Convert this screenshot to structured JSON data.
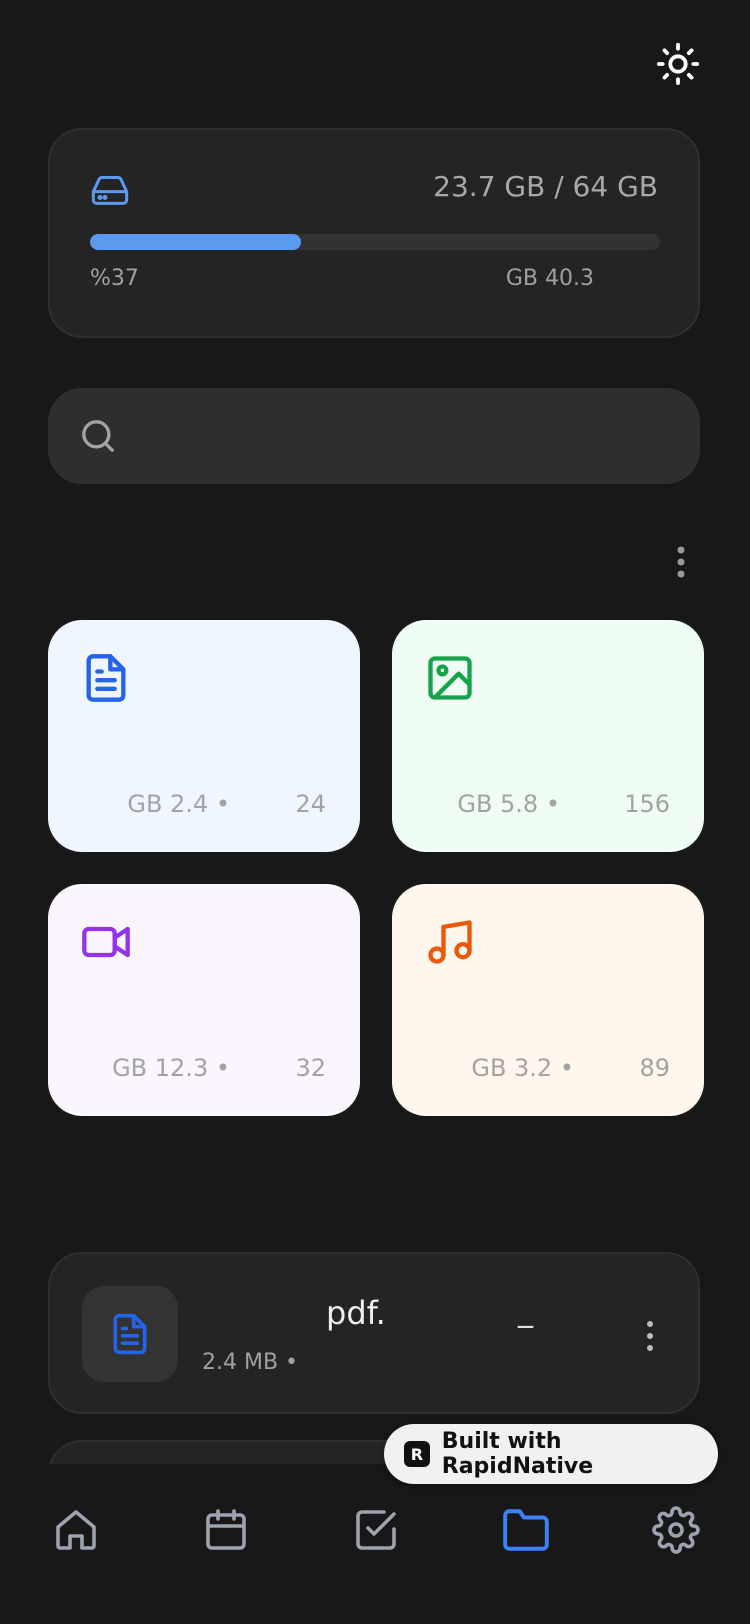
{
  "storage": {
    "total_label": "23.7 GB / 64 GB",
    "percent_label": "%37",
    "free_label": "GB 40.3",
    "used_fraction": 0.37,
    "bar_color": "#5a9bf0"
  },
  "search": {
    "placeholder": ""
  },
  "categories": [
    {
      "id": "documents",
      "icon": "document-icon",
      "size": "GB 2.4 •",
      "count": "24",
      "bg": "#eff6ff",
      "color": "#2563eb"
    },
    {
      "id": "images",
      "icon": "image-icon",
      "size": "GB 5.8 •",
      "count": "156",
      "bg": "#f0fdf4",
      "color": "#16a34a"
    },
    {
      "id": "videos",
      "icon": "video-icon",
      "size": "GB 12.3 •",
      "count": "32",
      "bg": "#faf5ff",
      "color": "#9333ea"
    },
    {
      "id": "music",
      "icon": "music-icon",
      "size": "GB 3.2 •",
      "count": "89",
      "bg": "#fff7ed",
      "color": "#ea580c"
    }
  ],
  "recent_files": [
    {
      "name": "pdf.",
      "meta": "2.4 MB •",
      "date": "_",
      "icon": "document-icon"
    }
  ],
  "tabs": [
    {
      "id": "home",
      "icon": "home-icon",
      "active": false
    },
    {
      "id": "calendar",
      "icon": "calendar-icon",
      "active": false
    },
    {
      "id": "tasks",
      "icon": "checkbox-icon",
      "active": false
    },
    {
      "id": "files",
      "icon": "folder-icon",
      "active": true
    },
    {
      "id": "settings",
      "icon": "gear-icon",
      "active": false
    }
  ],
  "badge": {
    "logo": "R",
    "label": "Built with RapidNative"
  },
  "colors": {
    "accent": "#3b82f6",
    "tab_inactive": "#9ca3af",
    "background": "#181818"
  }
}
